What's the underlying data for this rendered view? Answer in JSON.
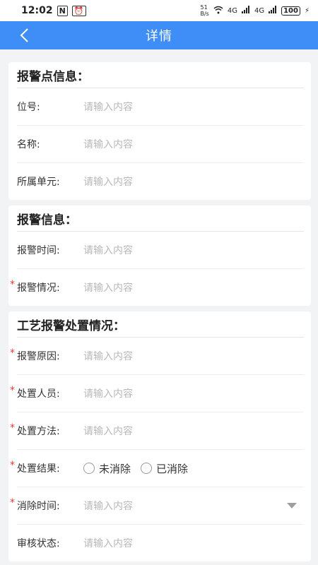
{
  "status": {
    "time": "12:02",
    "network_speed": "51\nB/s",
    "signal1": "4G",
    "signal2": "4G",
    "battery": "100"
  },
  "app_bar": {
    "title": "详情"
  },
  "section1": {
    "header": "报警点信息：",
    "rows": [
      {
        "label": "位号:",
        "placeholder": "请输入内容"
      },
      {
        "label": "名称:",
        "placeholder": "请输入内容"
      },
      {
        "label": "所属单元:",
        "placeholder": "请输入内容"
      }
    ]
  },
  "section2": {
    "header": "报警信息：",
    "rows": [
      {
        "label": "报警时间:",
        "placeholder": "请输入内容"
      },
      {
        "label": "报警情况:",
        "placeholder": "请输入内容"
      }
    ]
  },
  "section3": {
    "header": "工艺报警处置情况：",
    "rows": [
      {
        "label": "报警原因:",
        "placeholder": "请输入内容"
      },
      {
        "label": "处置人员:",
        "placeholder": "请输入内容"
      },
      {
        "label": "处置方法:",
        "placeholder": "请输入内容"
      },
      {
        "label": "处置结果:",
        "options": [
          "未消除",
          "已消除"
        ]
      },
      {
        "label": "消除时间:",
        "placeholder": "请输入内容"
      },
      {
        "label": "审核状态:",
        "placeholder": "请输入内容"
      }
    ]
  },
  "required_mark": "*",
  "colors": {
    "primary": "#3f8df7",
    "required": "#e53935",
    "placeholder": "#b8b8b8"
  }
}
